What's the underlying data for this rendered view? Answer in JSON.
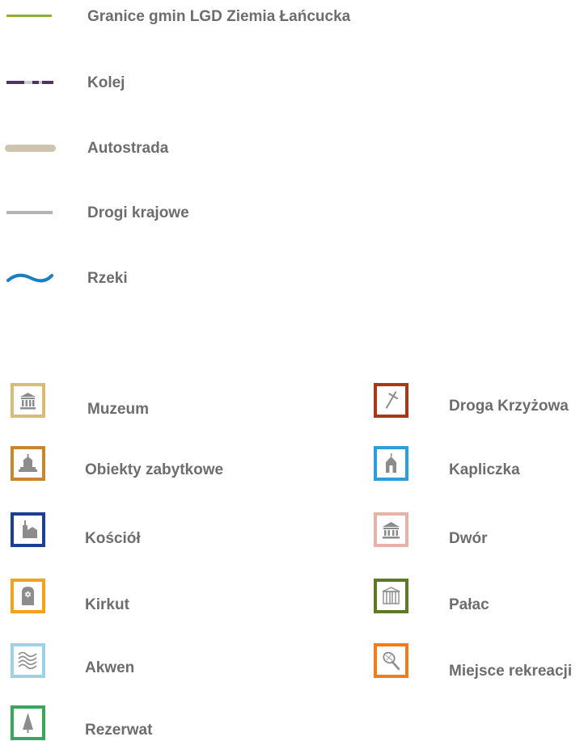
{
  "lines": [
    {
      "label": "Granice gmin LGD Ziemia Łańcucka",
      "symbol": "green-line-icon",
      "color": "#8db32a"
    },
    {
      "label": "Kolej",
      "symbol": "railway-line-icon",
      "color": "#4e3468"
    },
    {
      "label": "Autostrada",
      "symbol": "motorway-line-icon",
      "color": "#cfc3b2"
    },
    {
      "label": "Drogi krajowe",
      "symbol": "national-road-line-icon",
      "color": "#b3b3b3"
    },
    {
      "label": "Rzeki",
      "symbol": "river-wave-icon",
      "color": "#1c7dc0"
    }
  ],
  "points_left": [
    {
      "label": "Muzeum",
      "symbol": "museum-icon",
      "color": "#d8bc74"
    },
    {
      "label": "Obiekty zabytkowe",
      "symbol": "monument-icon",
      "color": "#c7862f"
    },
    {
      "label": "Kościół",
      "symbol": "church-icon",
      "color": "#1d3f8f"
    },
    {
      "label": "Kirkut",
      "symbol": "jewish-cemetery-icon",
      "color": "#f3a21b"
    },
    {
      "label": "Akwen",
      "symbol": "water-waves-icon",
      "color": "#9dd1ea"
    },
    {
      "label": "Rezerwat",
      "symbol": "reserve-tree-icon",
      "color": "#3aa65c"
    }
  ],
  "points_right": [
    {
      "label": "Droga Krzyżowa",
      "symbol": "way-of-cross-icon",
      "color": "#a83818"
    },
    {
      "label": "Kapliczka",
      "symbol": "chapel-icon",
      "color": "#2c9ed9"
    },
    {
      "label": "Dwór",
      "symbol": "manor-icon",
      "color": "#e5b3a8"
    },
    {
      "label": "Pałac",
      "symbol": "palace-icon",
      "color": "#5f7a25"
    },
    {
      "label": "Miejsce rekreacji",
      "symbol": "recreation-racket-icon",
      "color": "#f07d1a"
    }
  ]
}
